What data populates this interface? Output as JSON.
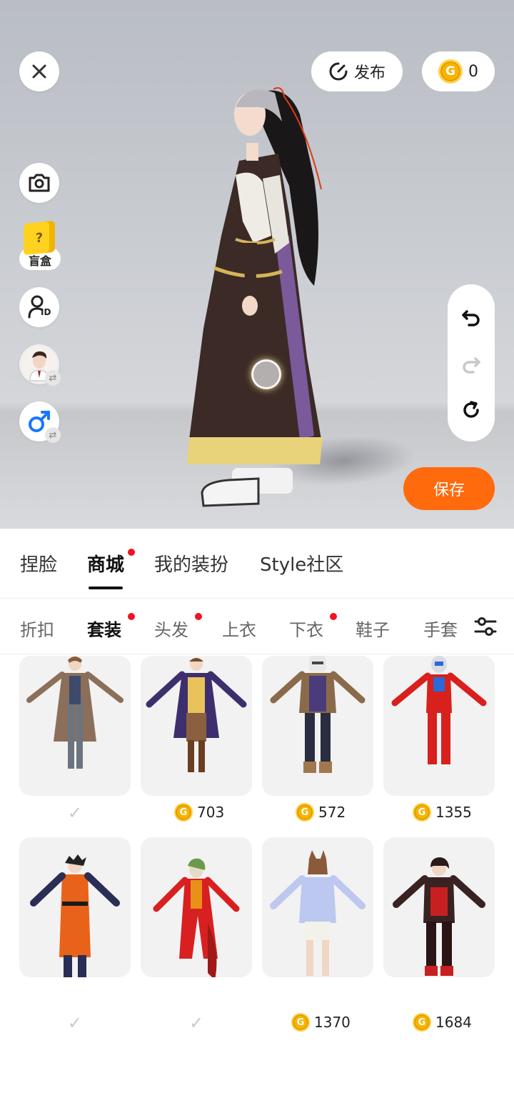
{
  "header": {
    "publish_label": "发布",
    "coin_balance": "0",
    "coin_symbol": "G"
  },
  "side_actions": {
    "mystery_box_label": "盲盒",
    "mystery_box_mark": "?",
    "id_label": "ID"
  },
  "save_label": "保存",
  "main_tabs": [
    {
      "label": "捏脸",
      "active": false
    },
    {
      "label": "商城",
      "active": true,
      "dot": true
    },
    {
      "label": "我的装扮",
      "active": false
    },
    {
      "label": "Style社区",
      "active": false
    }
  ],
  "sub_tabs": [
    {
      "label": "折扣"
    },
    {
      "label": "套装",
      "active": true,
      "dot": true
    },
    {
      "label": "头发",
      "dot": true
    },
    {
      "label": "上衣"
    },
    {
      "label": "下衣",
      "dot": true
    },
    {
      "label": "鞋子"
    },
    {
      "label": "手套"
    }
  ],
  "outfits": [
    {
      "price": null,
      "owned": true
    },
    {
      "price": "703",
      "owned": false
    },
    {
      "price": "572",
      "owned": false
    },
    {
      "price": "1355",
      "owned": false
    },
    {
      "price": null,
      "owned": true
    },
    {
      "price": null,
      "owned": true
    },
    {
      "price": "1370",
      "owned": false
    },
    {
      "price": "1684",
      "owned": false
    }
  ],
  "colors": {
    "accent": "#ff6a0d",
    "coin": "#f6b400",
    "dot": "#f0141e",
    "male": "#1677ff"
  },
  "icons": [
    "close-icon",
    "publish-icon",
    "coin-icon",
    "camera-icon",
    "mystery-box-icon",
    "avatar-id-icon",
    "avatar-switch-icon",
    "male-gender-icon",
    "undo-icon",
    "redo-icon",
    "reset-icon",
    "filter-icon",
    "check-icon"
  ]
}
